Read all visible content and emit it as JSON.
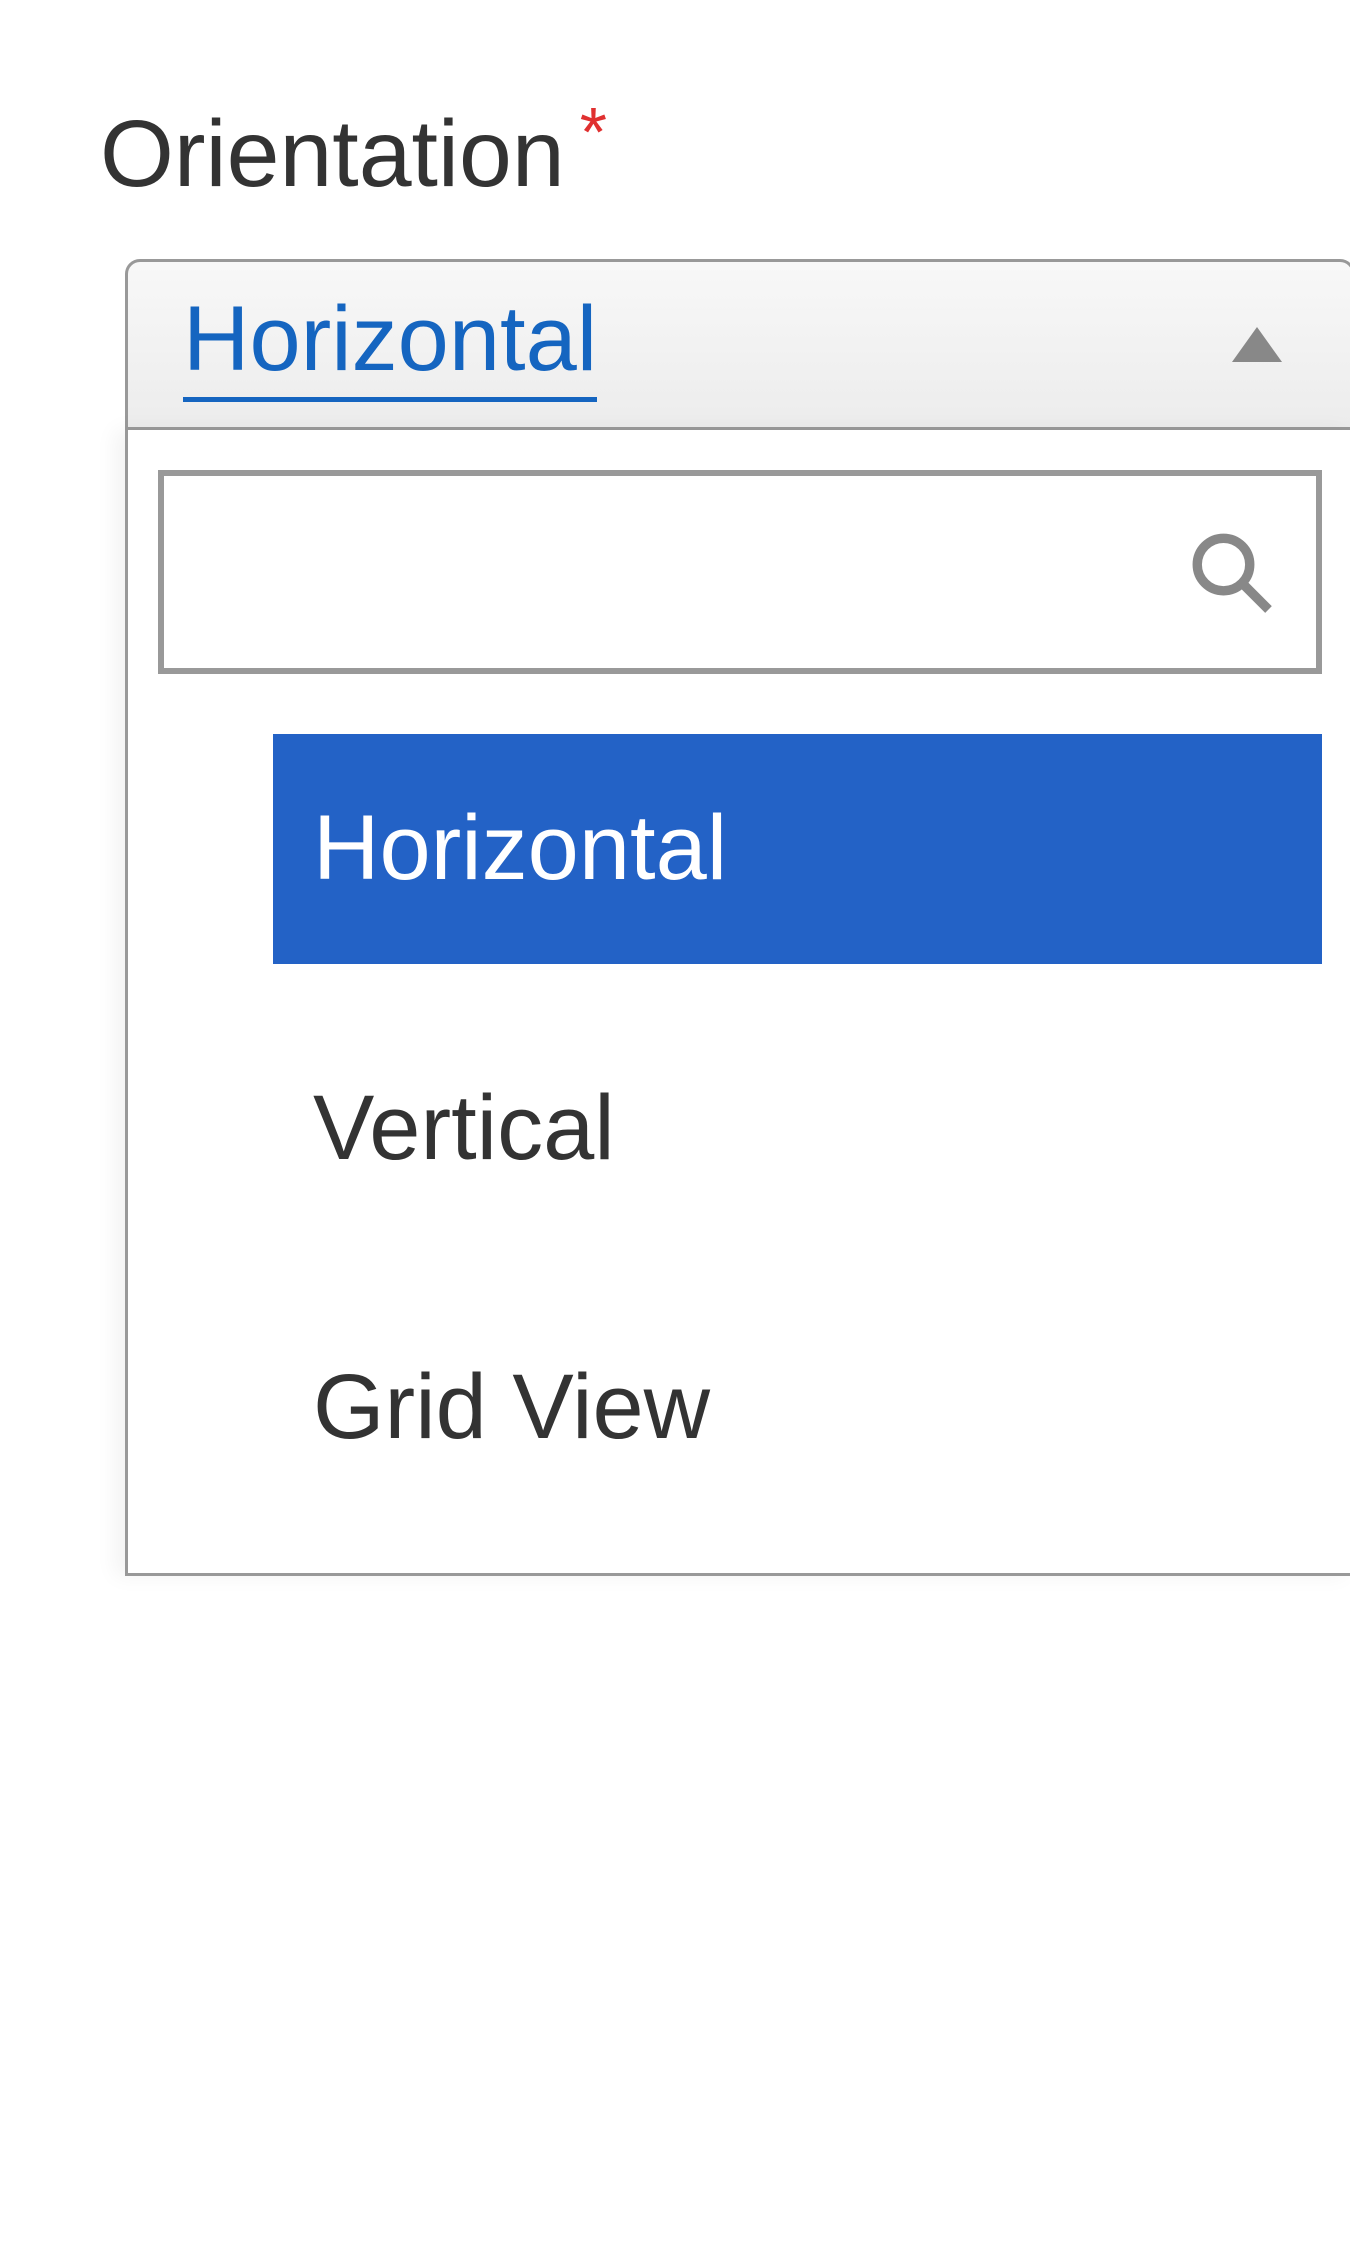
{
  "field": {
    "label": "Orientation",
    "required_marker": "*"
  },
  "dropdown": {
    "selected_value": "Horizontal",
    "search_value": "",
    "options": [
      {
        "label": "Horizontal",
        "selected": true
      },
      {
        "label": "Vertical",
        "selected": false
      },
      {
        "label": "Grid View",
        "selected": false
      }
    ]
  },
  "colors": {
    "link_blue": "#1565c0",
    "selected_bg": "#2362c6",
    "required_red": "#e03030"
  }
}
